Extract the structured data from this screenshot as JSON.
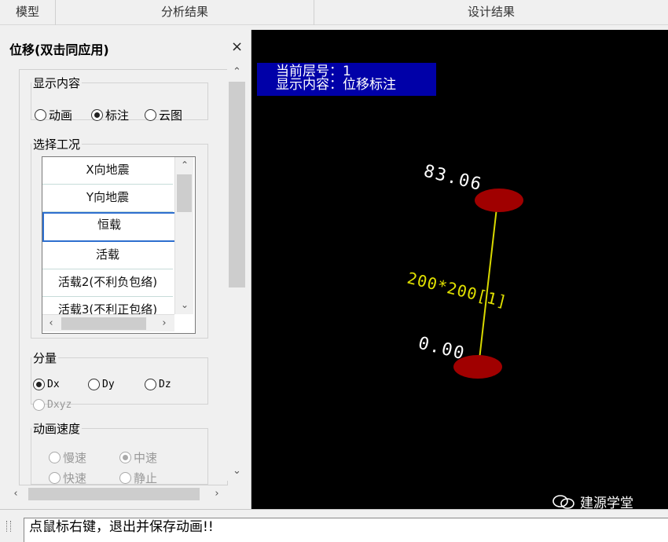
{
  "tabs": [
    {
      "label": "模型"
    },
    {
      "label": "分析结果"
    },
    {
      "label": "设计结果"
    }
  ],
  "panel": {
    "title": "位移(双击同应用)",
    "close_glyph": "×",
    "display_group": {
      "legend": "显示内容",
      "options": [
        "动画",
        "标注",
        "云图"
      ],
      "selected": "标注"
    },
    "case_group": {
      "legend": "选择工况",
      "items": [
        "X向地震",
        "Y向地震",
        "恒载",
        "活载",
        "活载2(不利负包络)",
        "活载3(不利正包络)"
      ],
      "selected": "恒载"
    },
    "component_group": {
      "legend": "分量",
      "options": [
        "Dx",
        "Dy",
        "Dz",
        "Dxyz"
      ],
      "selected": "Dx",
      "disabled": [
        "Dxyz"
      ]
    },
    "speed_group": {
      "legend": "动画速度",
      "options": [
        "慢速",
        "中速",
        "快速",
        "静止"
      ],
      "selected": "中速",
      "disabled": [
        "慢速",
        "中速",
        "快速",
        "静止"
      ]
    }
  },
  "viewport": {
    "floor_label": "当前层号：1",
    "content_label": "显示内容：位移标注",
    "top_value": "83.06",
    "bottom_value": "0.00",
    "member_label": "200*200[1]",
    "node_color": "#a00000",
    "member_color": "#d8d800",
    "watermark": "建源学堂"
  },
  "status": {
    "message": "点鼠标右键，退出并保存动画!!"
  }
}
